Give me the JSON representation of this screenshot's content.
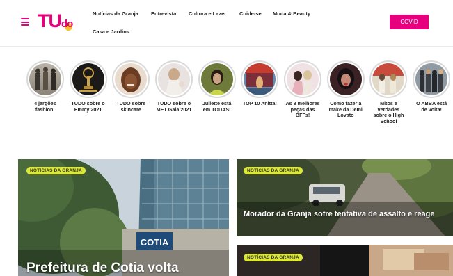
{
  "header": {
    "logo_text_main": "TU",
    "logo_text_sub": "do",
    "nav": [
      "Notícias da Granja",
      "Entrevista",
      "Cultura e Lazer",
      "Cuide-se",
      "Moda & Beauty",
      "Casa e Jardins"
    ],
    "covid_label": "COVID"
  },
  "stories": [
    {
      "label": "4 jargões fashion!"
    },
    {
      "label": "TUDO sobre o Emmy 2021"
    },
    {
      "label": "TUDO sobre skincare"
    },
    {
      "label": "TUDO sobre o MET Gala 2021"
    },
    {
      "label": "Juliette está em TODAS!"
    },
    {
      "label": "TOP 10 Anitta!"
    },
    {
      "label": "As 8 melhores peças das BFFs!"
    },
    {
      "label": "Como fazer a make da Demi Lovato"
    },
    {
      "label": "Mitos e verdades sobre o High School"
    },
    {
      "label": "O ABBA está de volta!"
    }
  ],
  "cards": [
    {
      "badge": "NOTÍCIAS DA GRANJA",
      "headline": "Prefeitura de Cotia volta",
      "sign_text": "COTIA"
    },
    {
      "badge": "NOTÍCIAS DA GRANJA",
      "headline": "Morador da Granja sofre tentativa de assalto e reage"
    },
    {
      "badge": "NOTÍCIAS DA GRANJA",
      "headline": ""
    }
  ],
  "colors": {
    "brand": "#e6007e",
    "logo_dot": "#f6c42a",
    "badge": "#dbe83a"
  },
  "icons": [
    "hamburger-menu-icon"
  ]
}
